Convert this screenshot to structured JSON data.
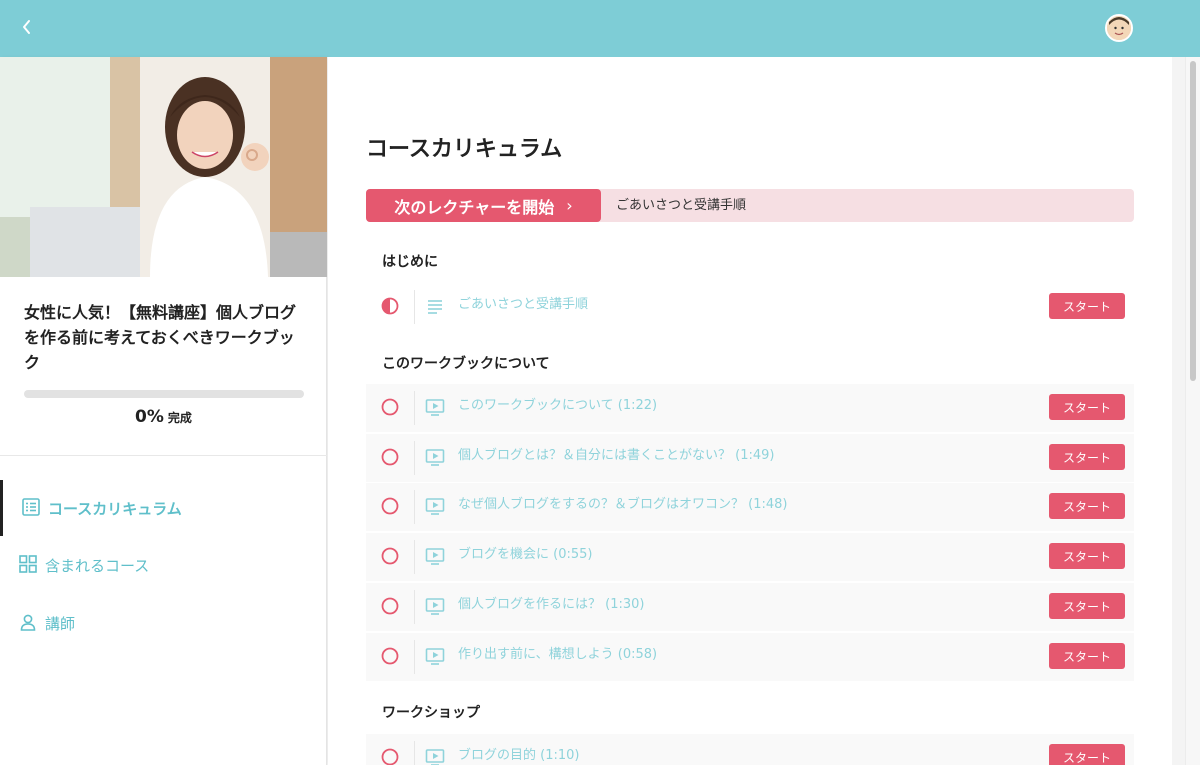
{
  "topbar": {
    "back_icon": "chevron-left-icon",
    "avatar_icon": "user-avatar"
  },
  "course": {
    "title": "女性に人気！【無料講座】個人ブログを作る前に考えておくべきワークブック",
    "progress_value": 0,
    "progress_percent": "0%",
    "progress_label": "完成"
  },
  "sidebar_nav": [
    {
      "label": "コースカリキュラム",
      "icon": "list-icon",
      "active": true
    },
    {
      "label": "含まれるコース",
      "icon": "grid-icon",
      "active": false
    },
    {
      "label": "講師",
      "icon": "user-icon",
      "active": false
    }
  ],
  "main": {
    "heading": "コースカリキュラム",
    "next_button": "次のレクチャーを開始",
    "next_chevron": "›",
    "next_lecture": "ごあいさつと受講手順"
  },
  "sections": [
    {
      "title": "はじめに"
    },
    {
      "title": "このワークブックについて"
    },
    {
      "title": "ワークショップ"
    }
  ],
  "lectures": [
    {
      "title": "ごあいさつと受講手順",
      "type": "text-icon",
      "status": "in-progress",
      "button": "スタート"
    },
    {
      "title": "このワークブックについて (1:22)",
      "type": "video-icon",
      "status": "not-started",
      "button": "スタート"
    },
    {
      "title": "個人ブログとは？＆自分には書くことがない？ (1:49)",
      "type": "video-icon",
      "status": "not-started",
      "button": "スタート"
    },
    {
      "title": "なぜ個人ブログをするの？＆ブログはオワコン？ (1:48)",
      "type": "video-icon",
      "status": "not-started",
      "button": "スタート"
    },
    {
      "title": "ブログを機会に (0:55)",
      "type": "video-icon",
      "status": "not-started",
      "button": "スタート"
    },
    {
      "title": "個人ブログを作るには？ (1:30)",
      "type": "video-icon",
      "status": "not-started",
      "button": "スタート"
    },
    {
      "title": "作り出す前に、構想しよう (0:58)",
      "type": "video-icon",
      "status": "not-started",
      "button": "スタート"
    },
    {
      "title": "ブログの目的 (1:10)",
      "type": "video-icon",
      "status": "not-started",
      "button": "スタート"
    }
  ],
  "colors": {
    "accent": "#e5586f",
    "teal": "#7ecdd6",
    "teal_text": "#5fbfca",
    "next_bar_bg": "#f6dfe3"
  }
}
